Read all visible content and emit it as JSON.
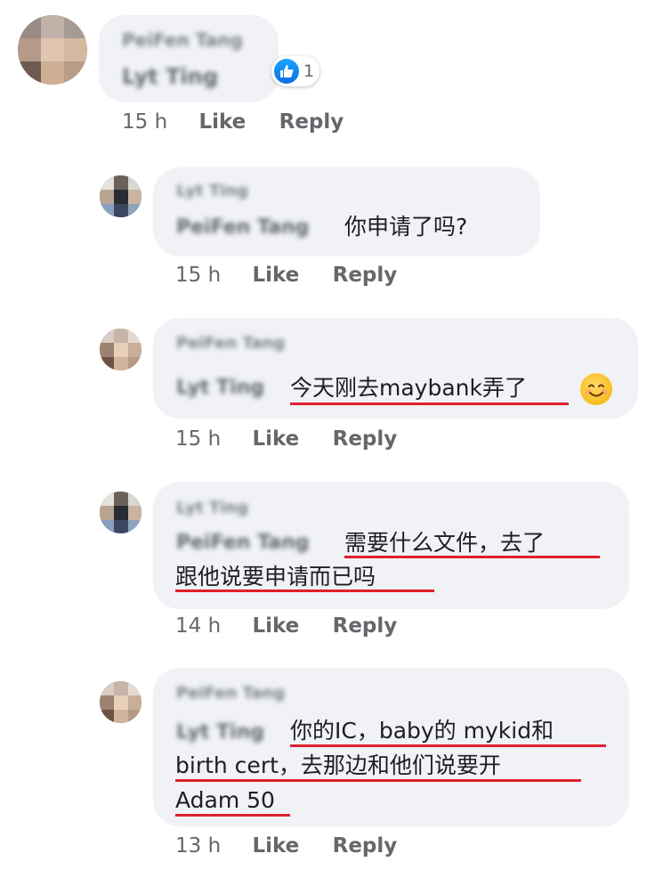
{
  "comments": [
    {
      "author": "PeiFen Tang",
      "mention": "Lyt Ting",
      "text": "",
      "time": "15 h",
      "reaction_count": "1"
    },
    {
      "author": "Lyt Ting",
      "mention": "PeiFen Tang",
      "text": "你申请了吗?",
      "time": "15 h"
    },
    {
      "author": "PeiFen Tang",
      "mention": "Lyt Ting",
      "text": "今天刚去maybank弄了",
      "emoji": "smiling-face",
      "time": "15 h"
    },
    {
      "author": "Lyt Ting",
      "mention": "PeiFen Tang",
      "text_line1": "需要什么文件，去了",
      "text_line2": "跟他说要申请而已吗",
      "time": "14 h"
    },
    {
      "author": "PeiFen Tang",
      "mention": "Lyt Ting",
      "text_line1": "你的IC，baby的 mykid和",
      "text_line2": "birth cert，去那边和他们说要开",
      "text_line3": "Adam 50",
      "time": "13 h"
    }
  ],
  "actions": {
    "like": "Like",
    "reply": "Reply"
  },
  "colors": {
    "bubble": "#f0f2f5",
    "underline": "#e0202e",
    "meta": "#65676b",
    "like_badge": "#1877f2"
  }
}
